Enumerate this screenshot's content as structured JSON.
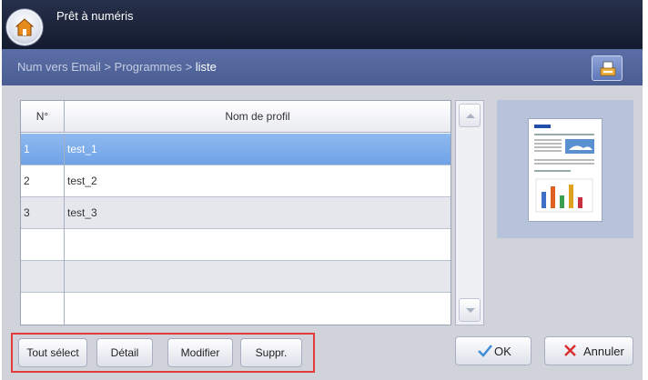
{
  "topbar": {
    "title": "Prêt à numéris",
    "home_icon": "home-icon"
  },
  "breadcrumb": {
    "path": "Num vers Email > Programmes > ",
    "current": "liste",
    "right_icon": "document-tray-icon"
  },
  "table": {
    "headers": {
      "no": "N°",
      "name": "Nom de profil"
    },
    "rows": [
      {
        "no": "1",
        "name": "test_1",
        "selected": true
      },
      {
        "no": "2",
        "name": "test_2",
        "selected": false
      },
      {
        "no": "3",
        "name": "test_3",
        "selected": false
      },
      {
        "no": "",
        "name": "",
        "selected": false
      },
      {
        "no": "",
        "name": "",
        "selected": false
      },
      {
        "no": "",
        "name": "",
        "selected": false
      }
    ]
  },
  "scrollbar": {
    "up_icon": "chevron-up-icon",
    "down_icon": "chevron-down-icon"
  },
  "preview": {
    "icon": "document-preview-thumbnail"
  },
  "actions": {
    "select_all": "Tout sélect",
    "detail": "Détail",
    "modify": "Modifier",
    "delete": "Suppr.",
    "ok": "OK",
    "cancel": "Annuler"
  },
  "colors": {
    "highlight_row": "#7aa9e8",
    "selection_frame": "#e23b3b",
    "ok_check": "#3f8fd8",
    "cancel_x": "#d83030"
  }
}
